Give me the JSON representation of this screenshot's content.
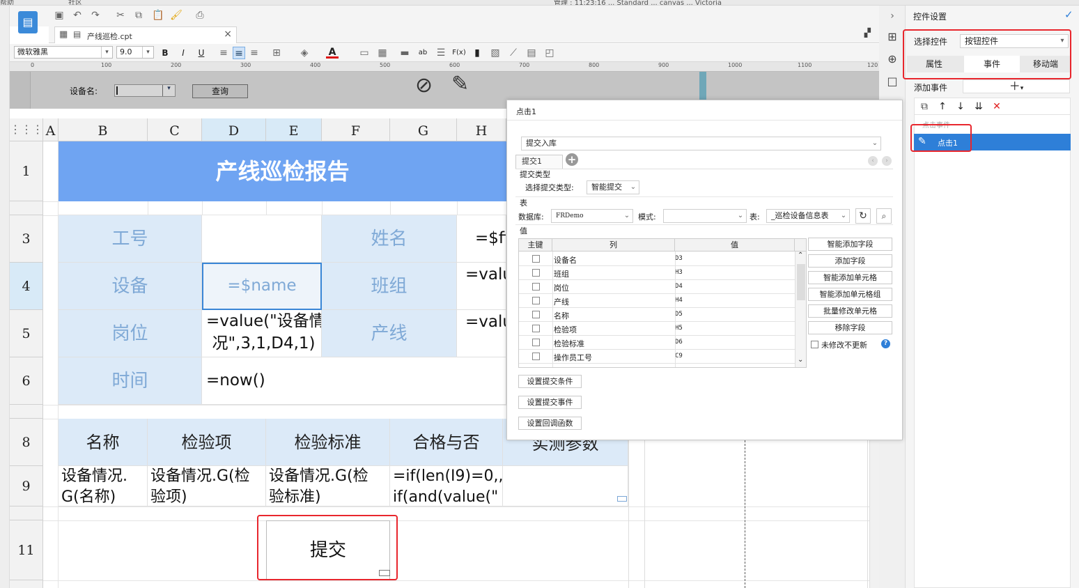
{
  "window": {
    "top_menu": [
      "帮助",
      "社区"
    ],
    "title_fragment": "管理 : 11:23:16 ... Standard ... canvas ... Victoria"
  },
  "toolbar": {
    "font_name": "微软雅黑",
    "font_size": "9.0",
    "bold": "B",
    "italic": "I",
    "underline": "U",
    "abc_label": "ab",
    "fx_label": "F(x)"
  },
  "file_tab": {
    "label": "产线巡检.cpt",
    "close": "×"
  },
  "ruler": [
    "0",
    "100",
    "200",
    "300",
    "400",
    "500",
    "600",
    "700",
    "800",
    "900",
    "1000",
    "1100",
    "120"
  ],
  "param_panel": {
    "device_label": "设备名:",
    "query_button": "查询"
  },
  "sheet": {
    "columns": [
      "A",
      "B",
      "C",
      "D",
      "E",
      "F",
      "G",
      "H"
    ],
    "rows": [
      "1",
      "3",
      "4",
      "5",
      "6",
      "8",
      "9",
      "11"
    ],
    "title": "产线巡检报告",
    "r3": {
      "b": "工号",
      "f": "姓名",
      "h": "=$fi"
    },
    "r4": {
      "b": "设备",
      "d": "=$name",
      "f": "班组",
      "h": "=valu"
    },
    "r5": {
      "b": "岗位",
      "d1": "=value(\"设备情",
      "d2": "况\",3,1,D4,1)",
      "f": "产线",
      "h": "=valu"
    },
    "r6": {
      "b": "时间",
      "d": "=now()"
    },
    "r8": [
      "名称",
      "检验项",
      "检验标准",
      "合格与否",
      "实测参数"
    ],
    "r9": {
      "b1": "设备情况.",
      "b2": "G(名称)",
      "c1": "设备情况.G(检",
      "c2": "验项)",
      "e1": "设备情况.G(检",
      "e2": "验标准)",
      "g1": "=if(len(I9)=0,,",
      "g2": "if(and(value(\""
    },
    "submit_button": "提交"
  },
  "dialog": {
    "title": "点击1",
    "action_type": "提交入库",
    "tab": "提交1",
    "submit_type_section": "提交类型",
    "submit_type_label": "选择提交类型:",
    "submit_type_value": "智能提交",
    "table_section": "表",
    "db_label": "数据库:",
    "db_value": "FRDemo",
    "mode_label": "模式:",
    "mode_value": "",
    "table_label": "表:",
    "table_value": "_巡检设备信息表",
    "value_section": "值",
    "headers": [
      "主键",
      "列",
      "值"
    ],
    "rows": [
      {
        "col": "设备名",
        "val": "D3"
      },
      {
        "col": "班组",
        "val": "H3"
      },
      {
        "col": "岗位",
        "val": "D4"
      },
      {
        "col": "产线",
        "val": "H4"
      },
      {
        "col": "名称",
        "val": "D5"
      },
      {
        "col": "检验项",
        "val": "H5"
      },
      {
        "col": "检验标准",
        "val": "D6"
      },
      {
        "col": "操作员工号",
        "val": "C9"
      }
    ],
    "side_buttons": [
      "智能添加字段",
      "添加字段",
      "智能添加单元格",
      "智能添加单元格组",
      "批量修改单元格",
      "移除字段"
    ],
    "not_modified_label": "未修改不更新",
    "bottom_buttons": [
      "设置提交条件",
      "设置提交事件",
      "设置回调函数"
    ]
  },
  "right_panel": {
    "title": "控件设置",
    "select_label": "选择控件",
    "select_value": "按钮控件",
    "tabs": [
      "属性",
      "事件",
      "移动端"
    ],
    "add_event_label": "添加事件",
    "event_group": "点击事件",
    "event_item": "点击1"
  },
  "colors": {
    "accent_blue": "#2e7fd8",
    "title_band": "#6fa4f2",
    "label_cell_bg": "#dceaf8",
    "annotation_red": "#e8262d"
  }
}
